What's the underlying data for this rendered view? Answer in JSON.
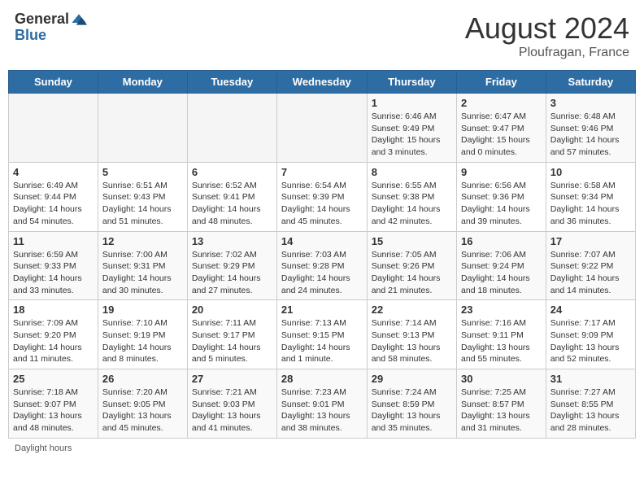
{
  "header": {
    "logo_general": "General",
    "logo_blue": "Blue",
    "month_title": "August 2024",
    "location": "Ploufragan, France"
  },
  "weekdays": [
    "Sunday",
    "Monday",
    "Tuesday",
    "Wednesday",
    "Thursday",
    "Friday",
    "Saturday"
  ],
  "footer": {
    "label": "Daylight hours"
  },
  "weeks": [
    [
      {
        "day": "",
        "info": ""
      },
      {
        "day": "",
        "info": ""
      },
      {
        "day": "",
        "info": ""
      },
      {
        "day": "",
        "info": ""
      },
      {
        "day": "1",
        "info": "Sunrise: 6:46 AM\nSunset: 9:49 PM\nDaylight: 15 hours and 3 minutes."
      },
      {
        "day": "2",
        "info": "Sunrise: 6:47 AM\nSunset: 9:47 PM\nDaylight: 15 hours and 0 minutes."
      },
      {
        "day": "3",
        "info": "Sunrise: 6:48 AM\nSunset: 9:46 PM\nDaylight: 14 hours and 57 minutes."
      }
    ],
    [
      {
        "day": "4",
        "info": "Sunrise: 6:49 AM\nSunset: 9:44 PM\nDaylight: 14 hours and 54 minutes."
      },
      {
        "day": "5",
        "info": "Sunrise: 6:51 AM\nSunset: 9:43 PM\nDaylight: 14 hours and 51 minutes."
      },
      {
        "day": "6",
        "info": "Sunrise: 6:52 AM\nSunset: 9:41 PM\nDaylight: 14 hours and 48 minutes."
      },
      {
        "day": "7",
        "info": "Sunrise: 6:54 AM\nSunset: 9:39 PM\nDaylight: 14 hours and 45 minutes."
      },
      {
        "day": "8",
        "info": "Sunrise: 6:55 AM\nSunset: 9:38 PM\nDaylight: 14 hours and 42 minutes."
      },
      {
        "day": "9",
        "info": "Sunrise: 6:56 AM\nSunset: 9:36 PM\nDaylight: 14 hours and 39 minutes."
      },
      {
        "day": "10",
        "info": "Sunrise: 6:58 AM\nSunset: 9:34 PM\nDaylight: 14 hours and 36 minutes."
      }
    ],
    [
      {
        "day": "11",
        "info": "Sunrise: 6:59 AM\nSunset: 9:33 PM\nDaylight: 14 hours and 33 minutes."
      },
      {
        "day": "12",
        "info": "Sunrise: 7:00 AM\nSunset: 9:31 PM\nDaylight: 14 hours and 30 minutes."
      },
      {
        "day": "13",
        "info": "Sunrise: 7:02 AM\nSunset: 9:29 PM\nDaylight: 14 hours and 27 minutes."
      },
      {
        "day": "14",
        "info": "Sunrise: 7:03 AM\nSunset: 9:28 PM\nDaylight: 14 hours and 24 minutes."
      },
      {
        "day": "15",
        "info": "Sunrise: 7:05 AM\nSunset: 9:26 PM\nDaylight: 14 hours and 21 minutes."
      },
      {
        "day": "16",
        "info": "Sunrise: 7:06 AM\nSunset: 9:24 PM\nDaylight: 14 hours and 18 minutes."
      },
      {
        "day": "17",
        "info": "Sunrise: 7:07 AM\nSunset: 9:22 PM\nDaylight: 14 hours and 14 minutes."
      }
    ],
    [
      {
        "day": "18",
        "info": "Sunrise: 7:09 AM\nSunset: 9:20 PM\nDaylight: 14 hours and 11 minutes."
      },
      {
        "day": "19",
        "info": "Sunrise: 7:10 AM\nSunset: 9:19 PM\nDaylight: 14 hours and 8 minutes."
      },
      {
        "day": "20",
        "info": "Sunrise: 7:11 AM\nSunset: 9:17 PM\nDaylight: 14 hours and 5 minutes."
      },
      {
        "day": "21",
        "info": "Sunrise: 7:13 AM\nSunset: 9:15 PM\nDaylight: 14 hours and 1 minute."
      },
      {
        "day": "22",
        "info": "Sunrise: 7:14 AM\nSunset: 9:13 PM\nDaylight: 13 hours and 58 minutes."
      },
      {
        "day": "23",
        "info": "Sunrise: 7:16 AM\nSunset: 9:11 PM\nDaylight: 13 hours and 55 minutes."
      },
      {
        "day": "24",
        "info": "Sunrise: 7:17 AM\nSunset: 9:09 PM\nDaylight: 13 hours and 52 minutes."
      }
    ],
    [
      {
        "day": "25",
        "info": "Sunrise: 7:18 AM\nSunset: 9:07 PM\nDaylight: 13 hours and 48 minutes."
      },
      {
        "day": "26",
        "info": "Sunrise: 7:20 AM\nSunset: 9:05 PM\nDaylight: 13 hours and 45 minutes."
      },
      {
        "day": "27",
        "info": "Sunrise: 7:21 AM\nSunset: 9:03 PM\nDaylight: 13 hours and 41 minutes."
      },
      {
        "day": "28",
        "info": "Sunrise: 7:23 AM\nSunset: 9:01 PM\nDaylight: 13 hours and 38 minutes."
      },
      {
        "day": "29",
        "info": "Sunrise: 7:24 AM\nSunset: 8:59 PM\nDaylight: 13 hours and 35 minutes."
      },
      {
        "day": "30",
        "info": "Sunrise: 7:25 AM\nSunset: 8:57 PM\nDaylight: 13 hours and 31 minutes."
      },
      {
        "day": "31",
        "info": "Sunrise: 7:27 AM\nSunset: 8:55 PM\nDaylight: 13 hours and 28 minutes."
      }
    ]
  ]
}
